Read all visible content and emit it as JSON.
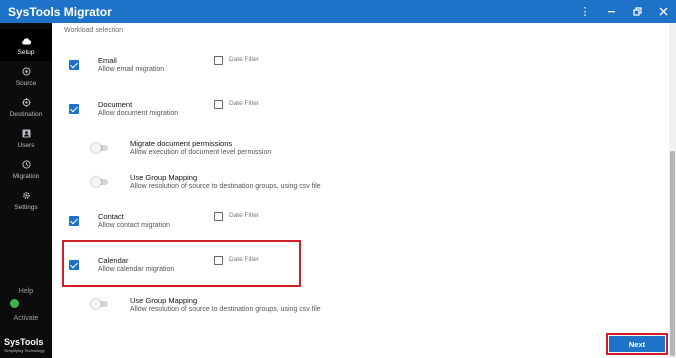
{
  "app": {
    "title": "SysTools Migrator"
  },
  "window_controls": [
    "menu",
    "minimize",
    "restore",
    "close"
  ],
  "sidebar": {
    "items": [
      {
        "label": "Setup",
        "icon": "cloud-icon",
        "active": true
      },
      {
        "label": "Source",
        "icon": "home-icon",
        "active": false
      },
      {
        "label": "Destination",
        "icon": "target-icon",
        "active": false
      },
      {
        "label": "Users",
        "icon": "users-icon",
        "active": false
      },
      {
        "label": "Migration",
        "icon": "clock-icon",
        "active": false
      },
      {
        "label": "Settings",
        "icon": "gear-icon",
        "active": false
      }
    ],
    "help_label": "Help",
    "activate_label": "Activate",
    "brand_name": "SysTools",
    "brand_tagline": "Simplifying Technology"
  },
  "main": {
    "section_title": "Workload selection",
    "date_filter_label": "Date Filter",
    "items": [
      {
        "label": "Email",
        "description": "Allow email migration",
        "checked": true
      },
      {
        "label": "Document",
        "description": "Allow document migration",
        "checked": true
      },
      {
        "label": "Contact",
        "description": "Allow contact migration",
        "checked": true
      },
      {
        "label": "Calendar",
        "description": "Allow calendar migration",
        "checked": true
      }
    ],
    "sub_options": [
      {
        "label": "Migrate document permissions",
        "description": "Allow execution of document level permission",
        "enabled": false
      },
      {
        "label": "Use Group Mapping",
        "description": "Allow resolution of source to destination groups, using csv file",
        "enabled": false
      },
      {
        "label": "Use Group Mapping",
        "description": "Allow resolution of source to destination groups, using csv file",
        "enabled": false
      }
    ],
    "next_label": "Next"
  },
  "colors": {
    "accent": "#1e73c8",
    "sidebar_bg": "#0c0c0c",
    "highlight": "#d11f26"
  }
}
